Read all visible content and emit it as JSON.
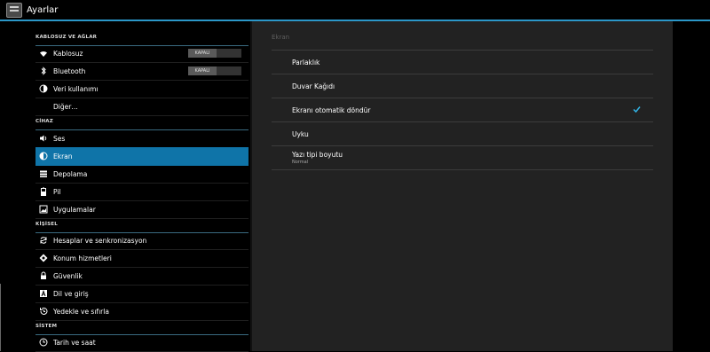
{
  "actionbar": {
    "title": "Ayarlar",
    "icon": "settings-app-icon"
  },
  "sidebar": {
    "sections": [
      {
        "header": "KABLOSUZ VE AĞLAR"
      },
      {
        "header": "CİHAZ"
      },
      {
        "header": "KİŞİSEL"
      },
      {
        "header": "SİSTEM"
      }
    ],
    "items": [
      {
        "label": "Kablosuz",
        "icon": "wifi-icon",
        "toggle": "KAPALI"
      },
      {
        "label": "Bluetooth",
        "icon": "bluetooth-icon",
        "toggle": "KAPALI"
      },
      {
        "label": "Veri kullanımı",
        "icon": "data-usage-icon"
      },
      {
        "label": "Diğer…"
      },
      {
        "label": "Ses",
        "icon": "volume-icon"
      },
      {
        "label": "Ekran",
        "icon": "display-icon",
        "selected": true
      },
      {
        "label": "Depolama",
        "icon": "storage-icon"
      },
      {
        "label": "Pil",
        "icon": "battery-icon"
      },
      {
        "label": "Uygulamalar",
        "icon": "apps-icon"
      },
      {
        "label": "Hesaplar ve senkronizasyon",
        "icon": "sync-icon"
      },
      {
        "label": "Konum hizmetleri",
        "icon": "location-icon"
      },
      {
        "label": "Güvenlik",
        "icon": "lock-icon"
      },
      {
        "label": "Dil ve giriş",
        "icon": "language-icon"
      },
      {
        "label": "Yedekle ve sıfırla",
        "icon": "backup-icon"
      },
      {
        "label": "Tarih ve saat",
        "icon": "clock-icon"
      }
    ]
  },
  "detail": {
    "title": "Ekran",
    "rows": [
      {
        "label": "Parlaklık"
      },
      {
        "label": "Duvar Kağıdı"
      },
      {
        "label": "Ekranı otomatik döndür",
        "checked": true
      },
      {
        "label": "Uyku"
      },
      {
        "label": "Yazı tipi boyutu",
        "summary": "Normal"
      }
    ]
  },
  "colors": {
    "accent": "#0f74a8",
    "checkbox": "#32b4e6",
    "divider": "#2b97c8"
  }
}
